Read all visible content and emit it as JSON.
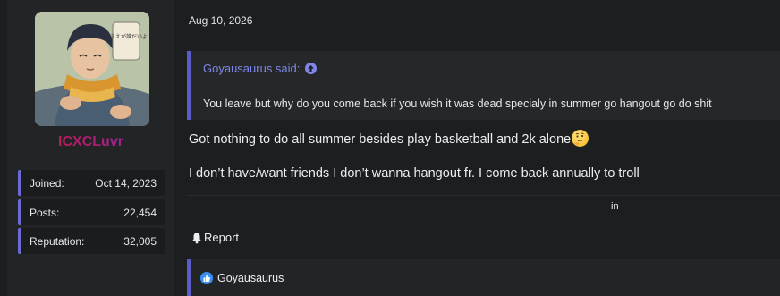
{
  "user": {
    "username": "ICXCLuvr",
    "avatar_speech": "おまえが誰だいよ",
    "stats": [
      {
        "label": "Joined:",
        "value": "Oct 14, 2023"
      },
      {
        "label": "Posts:",
        "value": "22,454"
      },
      {
        "label": "Reputation:",
        "value": "32,005"
      }
    ]
  },
  "post": {
    "date": "Aug 10, 2026",
    "quote": {
      "author": "Goyausaurus said:",
      "text": "You leave but why do you come back if you wish it was dead specialy in summer go hangout go do shit"
    },
    "body": [
      "Got nothing to do all summer besides play basketball and 2k alone",
      "I don’t have/want friends I don’t wanna hangout fr. I come back annually to troll"
    ],
    "emoji": "thinking-face",
    "signature_text": "in",
    "report_label": "Report",
    "reaction_user": "Goyausaurus"
  },
  "colors": {
    "accent": "#5c5cc9",
    "quote_author": "#7f86e8",
    "like": "#3a8ff2",
    "background": "#1d1e20"
  }
}
